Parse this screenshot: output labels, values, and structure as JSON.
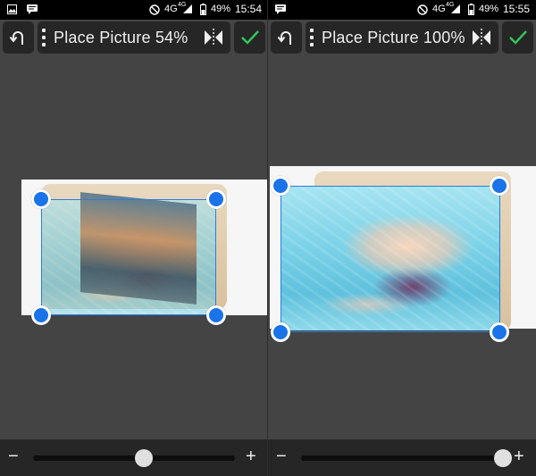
{
  "status": {
    "left": {
      "network": "4G",
      "network_sup": "4G",
      "battery": "49%",
      "clock": "15:54"
    },
    "right": {
      "network": "4G",
      "network_sup": "4G",
      "battery": "49%",
      "clock": "15:55"
    }
  },
  "toolbar": {
    "left_title": "Place Picture 54%",
    "right_title": "Place Picture 100%"
  },
  "zoom": {
    "minus": "−",
    "plus": "+",
    "left_level": 0.54,
    "right_level": 1.0
  },
  "colors": {
    "accent": "#1a73e8",
    "confirm": "#34c759",
    "toolbar_button": "#262626",
    "background": "#444444"
  },
  "icons": {
    "undo": "undo-icon",
    "menu": "kebab-menu-icon",
    "flip": "flip-horizontal-icon",
    "confirm": "checkmark-icon"
  }
}
